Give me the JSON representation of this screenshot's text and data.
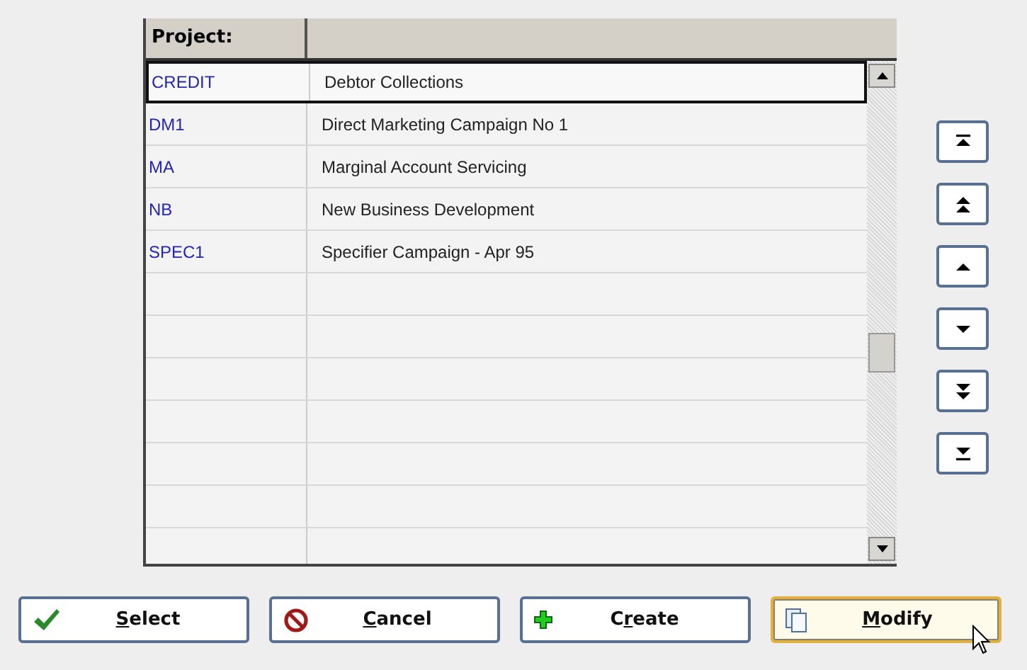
{
  "table": {
    "columns": [
      {
        "label": "Project:"
      }
    ],
    "rows": [
      {
        "code": "CREDIT",
        "description": "Debtor Collections",
        "selected": true
      },
      {
        "code": "DM1",
        "description": "Direct Marketing Campaign No 1",
        "selected": false
      },
      {
        "code": "MA",
        "description": "Marginal Account Servicing",
        "selected": false
      },
      {
        "code": "NB",
        "description": "New Business Development",
        "selected": false
      },
      {
        "code": "SPEC1",
        "description": "Specifier Campaign - Apr 95",
        "selected": false
      }
    ]
  },
  "nav_buttons": [
    {
      "kind": "first"
    },
    {
      "kind": "page_up"
    },
    {
      "kind": "up"
    },
    {
      "kind": "down"
    },
    {
      "kind": "page_down"
    },
    {
      "kind": "last"
    }
  ],
  "buttons": [
    {
      "kind": "select",
      "access_key": "S",
      "label_rest": "elect",
      "focused": false
    },
    {
      "kind": "cancel",
      "access_key": "C",
      "label_rest": "ancel",
      "focused": false
    },
    {
      "kind": "create",
      "label_start": "C",
      "access_key": "r",
      "label_rest": "eate",
      "focused": false
    },
    {
      "kind": "modify",
      "access_key": "M",
      "label_rest": "odify",
      "focused": true
    }
  ]
}
